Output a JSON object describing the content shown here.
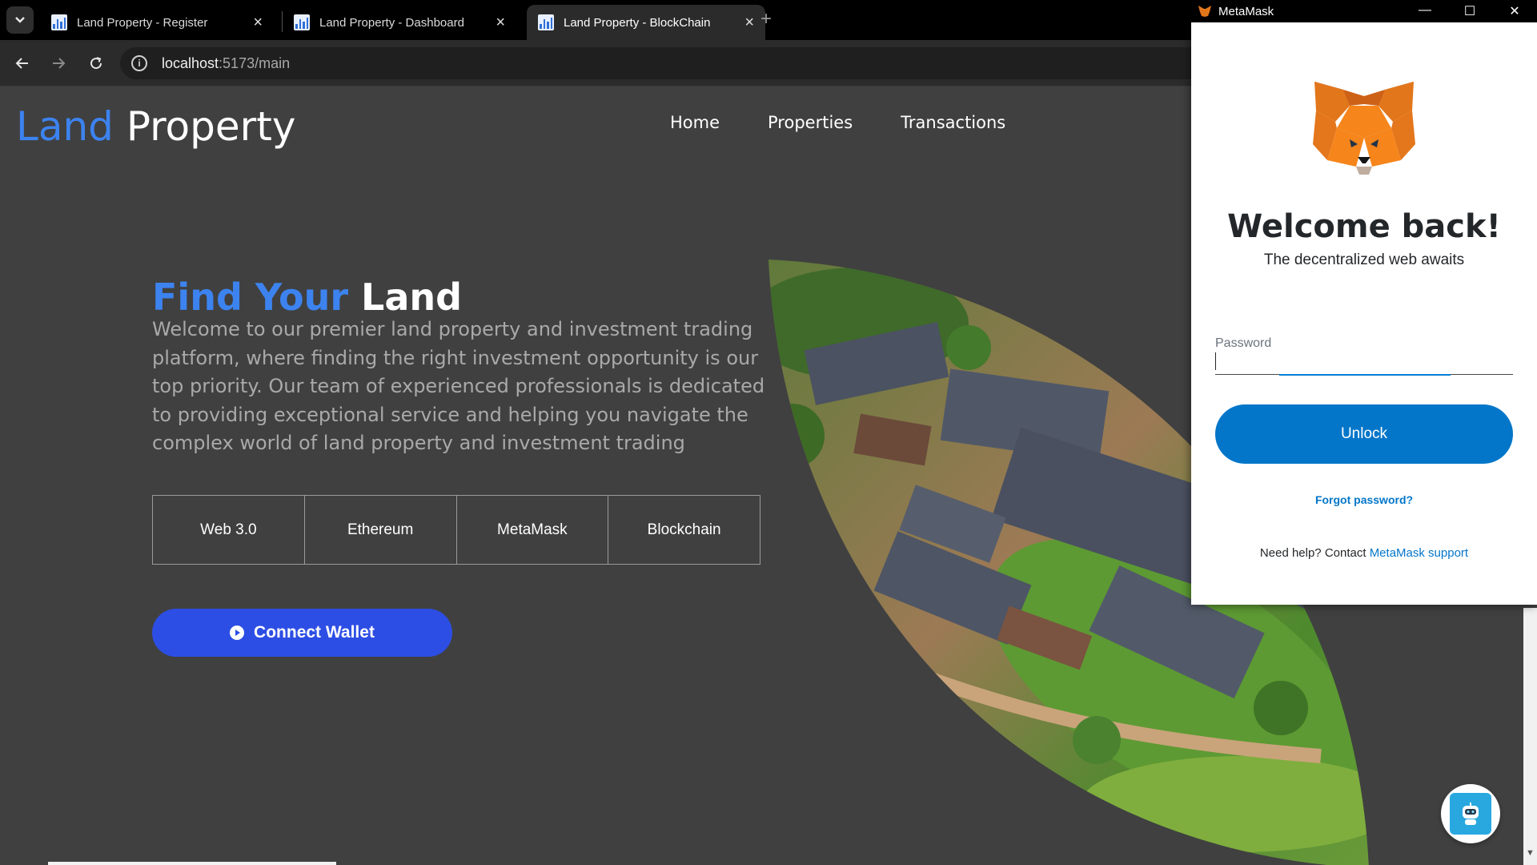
{
  "browser": {
    "tabs": [
      {
        "title": "Land Property - Register",
        "active": false
      },
      {
        "title": "Land Property - Dashboard",
        "active": false
      },
      {
        "title": "Land Property - BlockChain",
        "active": true
      }
    ],
    "new_tab": "+",
    "url_host": "localhost",
    "url_path": ":5173/main"
  },
  "site": {
    "logo_part1": "Land",
    "logo_part2": " Property",
    "nav": [
      "Home",
      "Properties",
      "Transactions"
    ]
  },
  "hero": {
    "title_part1": "Find Your",
    "title_part2": " Land",
    "description": "Welcome to our premier land property and investment trading platform, where finding the right investment opportunity is our top priority. Our team of experienced professionals is dedicated to providing exceptional service and helping you navigate the complex world of land property and investment trading",
    "tags": [
      "Web 3.0",
      "Ethereum",
      "MetaMask",
      "Blockchain"
    ],
    "connect_label": "Connect Wallet"
  },
  "metamask": {
    "window_title": "MetaMask",
    "welcome": "Welcome back!",
    "subtitle": "The decentralized web awaits",
    "password_label": "Password",
    "password_value": "",
    "unlock_label": "Unlock",
    "forgot_label": "Forgot password?",
    "help_text": "Need help? Contact ",
    "help_link": "MetaMask support"
  },
  "colors": {
    "page_bg": "#404040",
    "accent_blue": "#3c83f0",
    "connect_button": "#2d4ee4",
    "metamask_blue": "#0376c9"
  }
}
